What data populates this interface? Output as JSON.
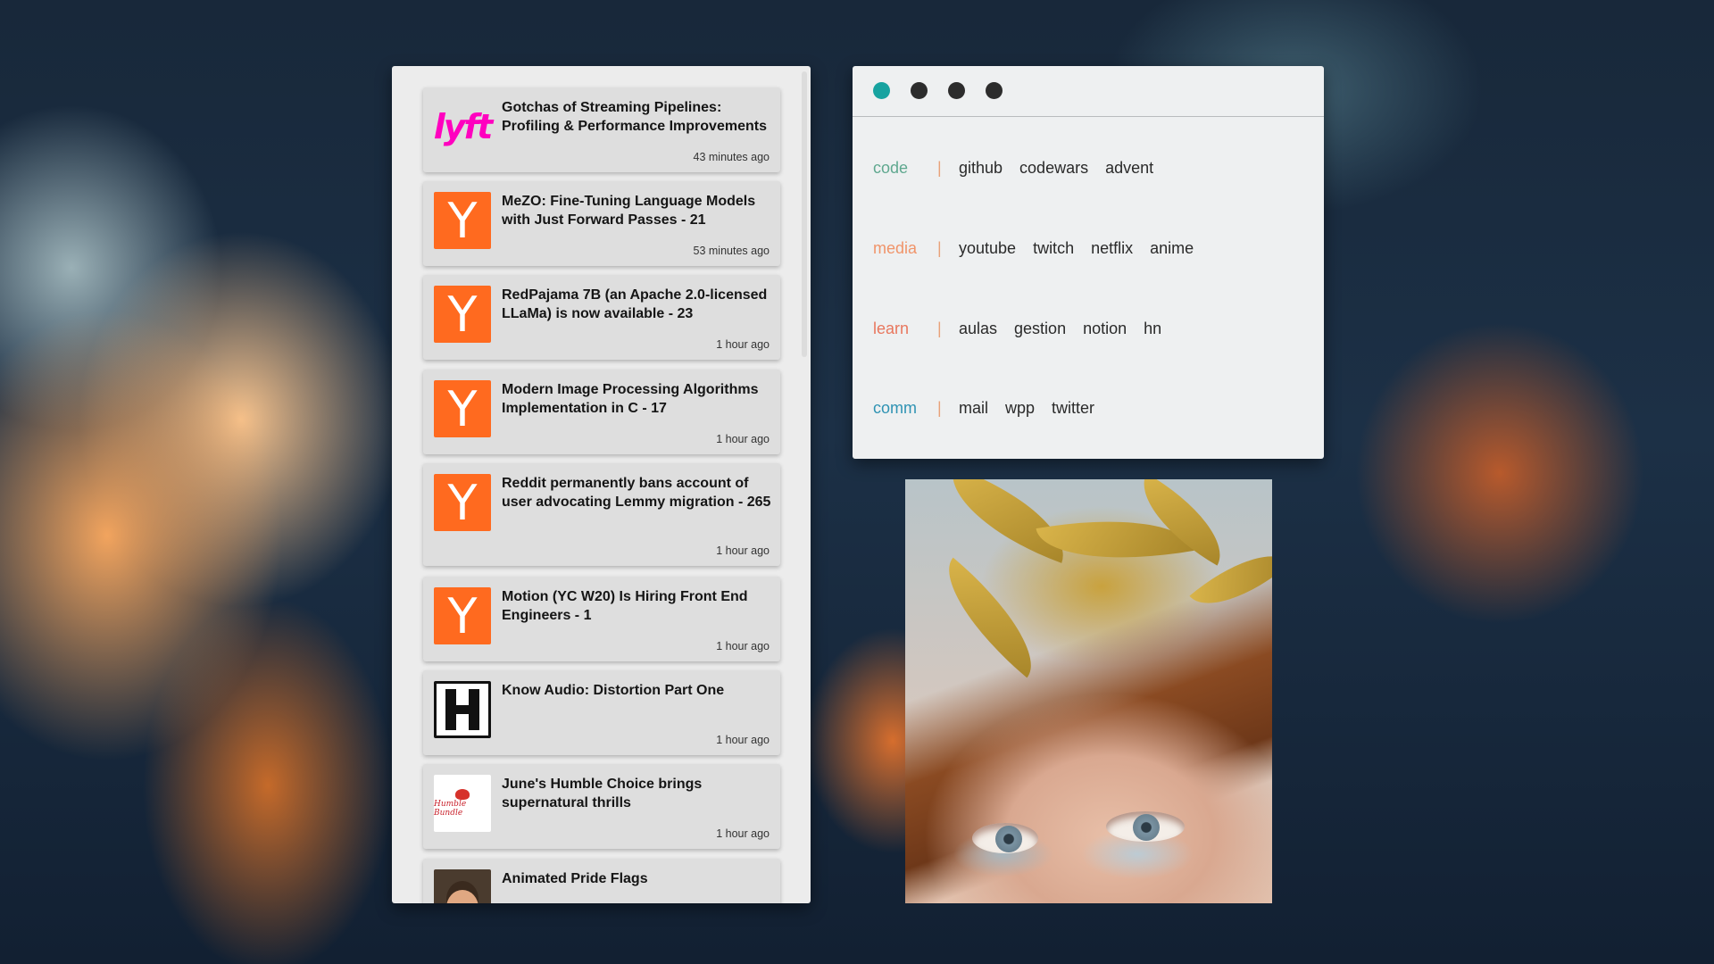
{
  "feed": {
    "items": [
      {
        "source": "lyft",
        "icon": "lyft-logo-icon",
        "logo_text": "lyft",
        "title": "Gotchas of Streaming Pipelines: Profiling & Performance Improvements",
        "time": "43 minutes ago"
      },
      {
        "source": "yc",
        "icon": "y-combinator-icon",
        "logo_text": "Y",
        "title": "MeZO: Fine-Tuning Language Models with Just Forward Passes - 21",
        "time": "53 minutes ago"
      },
      {
        "source": "yc",
        "icon": "y-combinator-icon",
        "logo_text": "Y",
        "title": "RedPajama 7B (an Apache 2.0-licensed LLaMa) is now available - 23",
        "time": "1 hour ago"
      },
      {
        "source": "yc",
        "icon": "y-combinator-icon",
        "logo_text": "Y",
        "title": "Modern Image Processing Algorithms Implementation in C - 17",
        "time": "1 hour ago"
      },
      {
        "source": "yc",
        "icon": "y-combinator-icon",
        "logo_text": "Y",
        "title": "Reddit permanently bans account of user advocating Lemmy migration - 265",
        "time": "1 hour ago"
      },
      {
        "source": "yc",
        "icon": "y-combinator-icon",
        "logo_text": "Y",
        "title": "Motion (YC W20) Is Hiring Front End Engineers - 1",
        "time": "1 hour ago"
      },
      {
        "source": "h",
        "icon": "h-logo-icon",
        "logo_text": "",
        "title": "Know Audio: Distortion Part One",
        "time": "1 hour ago"
      },
      {
        "source": "humble",
        "icon": "humble-bundle-icon",
        "logo_text": "Humble Bundle",
        "title": "June's Humble Choice brings supernatural thrills",
        "time": "1 hour ago"
      },
      {
        "source": "pride",
        "icon": "avatar-thumbnail-icon",
        "logo_text": "",
        "title": "Animated Pride Flags",
        "time": ""
      }
    ]
  },
  "launcher": {
    "dots": [
      {
        "icon": "window-dot-icon",
        "color": "#17a3a0"
      },
      {
        "icon": "window-dot-icon",
        "color": "#2c2c2c"
      },
      {
        "icon": "window-dot-icon",
        "color": "#2c2c2c"
      },
      {
        "icon": "window-dot-icon",
        "color": "#2c2c2c"
      }
    ],
    "separator": "|",
    "separator_color": "#e8a27a",
    "groups": [
      {
        "name": "code",
        "color": "#5fa88f",
        "links": [
          "github",
          "codewars",
          "advent"
        ]
      },
      {
        "name": "media",
        "color": "#f0946a",
        "links": [
          "youtube",
          "twitch",
          "netflix",
          "anime"
        ]
      },
      {
        "name": "learn",
        "color": "#e8775e",
        "links": [
          "aulas",
          "gestion",
          "notion",
          "hn"
        ]
      },
      {
        "name": "comm",
        "color": "#2f93b3",
        "links": [
          "mail",
          "wpp",
          "twitter"
        ]
      }
    ]
  },
  "colors": {
    "yc_orange": "#ff6a1f",
    "lyft_pink": "#ff00bf",
    "accent_teal": "#17a3a0"
  }
}
